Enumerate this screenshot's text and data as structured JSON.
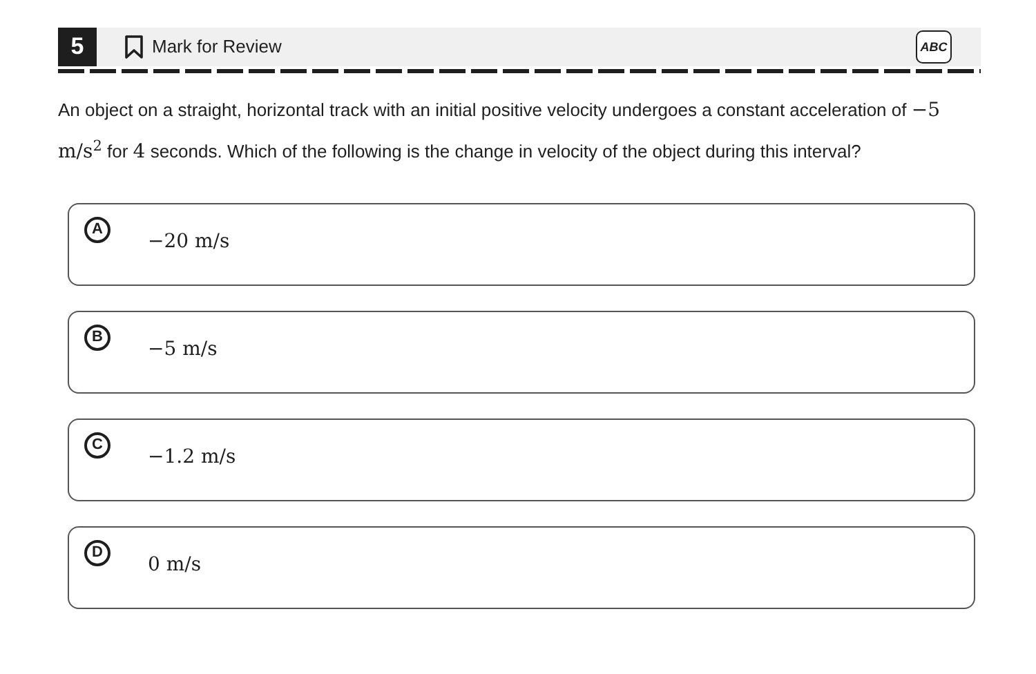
{
  "question_number": "5",
  "mark_for_review": {
    "label": "Mark for Review"
  },
  "eliminator": {
    "label": "ABC"
  },
  "question": [
    {
      "kind": "text",
      "text": "An object on a straight, horizontal track with an initial positive velocity undergoes a constant acceleration of "
    },
    {
      "kind": "math",
      "text": "−5 m/s$^{2}$"
    },
    {
      "kind": "text",
      "text": " for "
    },
    {
      "kind": "math",
      "text": "4"
    },
    {
      "kind": "text",
      "text": " seconds. Which of the following is the change in velocity of the object during this interval?"
    }
  ],
  "options": [
    {
      "letter": "A",
      "text": "−20 m/s"
    },
    {
      "letter": "B",
      "text": "−5 m/s"
    },
    {
      "letter": "C",
      "text": "−1.2 m/s"
    },
    {
      "letter": "D",
      "text": "0 m/s"
    }
  ]
}
